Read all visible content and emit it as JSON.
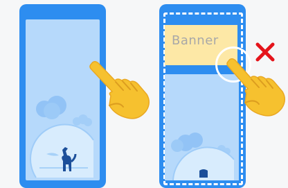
{
  "banner": {
    "label": "Banner"
  },
  "colors": {
    "phone_frame": "#2d8df0",
    "screen": "#b6d9fb",
    "banner_bg": "#fde8a6",
    "x_mark": "#e4141b"
  },
  "icons": [
    "pointing-hand-icon",
    "cross-icon",
    "dog-illustration"
  ]
}
